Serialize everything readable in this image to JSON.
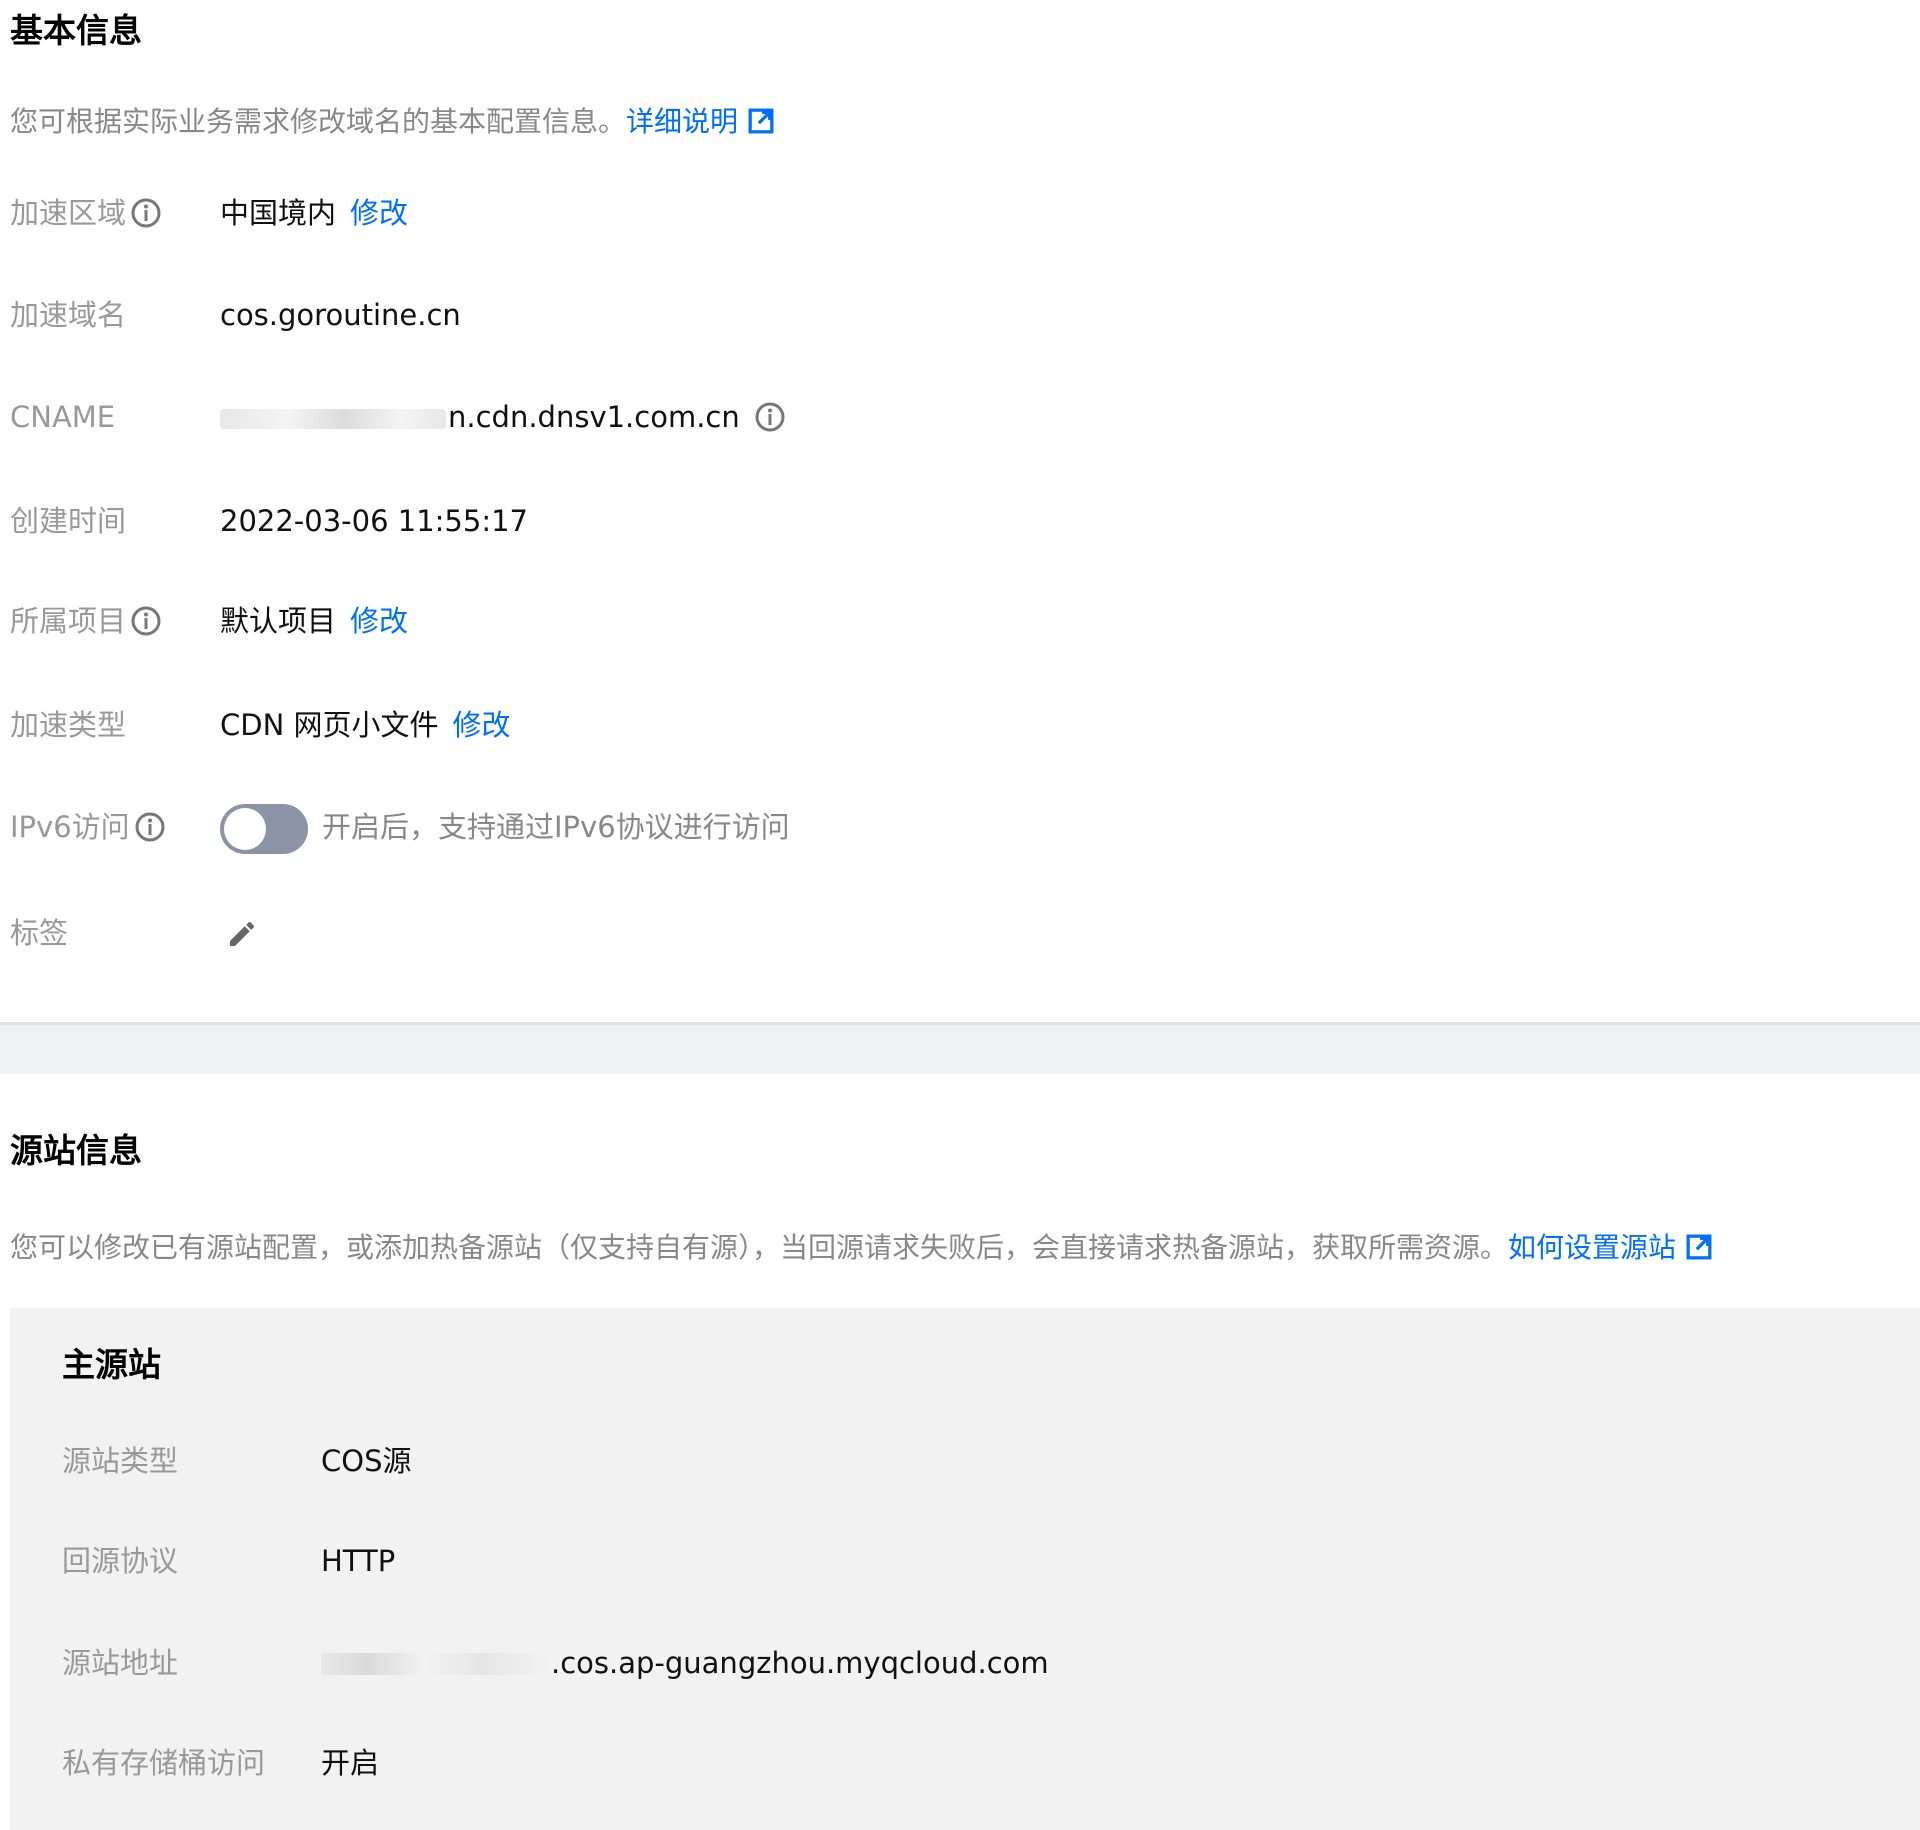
{
  "basic": {
    "title": "基本信息",
    "description": "您可根据实际业务需求修改域名的基本配置信息。",
    "doc_link": "详细说明",
    "rows": {
      "area": {
        "label": "加速区域",
        "value": "中国境内",
        "action": "修改"
      },
      "domain": {
        "label": "加速域名",
        "value": "cos.goroutine.cn"
      },
      "cname": {
        "label": "CNAME",
        "value_suffix": "n.cdn.dnsv1.com.cn"
      },
      "created": {
        "label": "创建时间",
        "value": "2022-03-06 11:55:17"
      },
      "project": {
        "label": "所属项目",
        "value": "默认项目",
        "action": "修改"
      },
      "type": {
        "label": "加速类型",
        "value": "CDN 网页小文件",
        "action": "修改"
      },
      "ipv6": {
        "label": "IPv6访问",
        "enabled": false,
        "hint": "开启后，支持通过IPv6协议进行访问"
      },
      "tags": {
        "label": "标签"
      }
    }
  },
  "origin": {
    "title": "源站信息",
    "description": "您可以修改已有源站配置，或添加热备源站（仅支持自有源），当回源请求失败后，会直接请求热备源站，获取所需资源。",
    "doc_link": "如何设置源站",
    "primary": {
      "title": "主源站",
      "rows": {
        "type": {
          "label": "源站类型",
          "value": "COS源"
        },
        "protocol": {
          "label": "回源协议",
          "value": "HTTP"
        },
        "address": {
          "label": "源站地址",
          "value_suffix": ".cos.ap-guangzhou.myqcloud.com"
        },
        "private": {
          "label": "私有存储桶访问",
          "value": "开启"
        }
      }
    }
  },
  "colors": {
    "link": "#006eff",
    "label": "#999999",
    "toggle_off": "#8a94a6",
    "panel_bg": "#f2f2f2"
  },
  "icons": {
    "external_link": "external-link-icon",
    "info": "info-icon",
    "edit": "pencil-icon"
  }
}
